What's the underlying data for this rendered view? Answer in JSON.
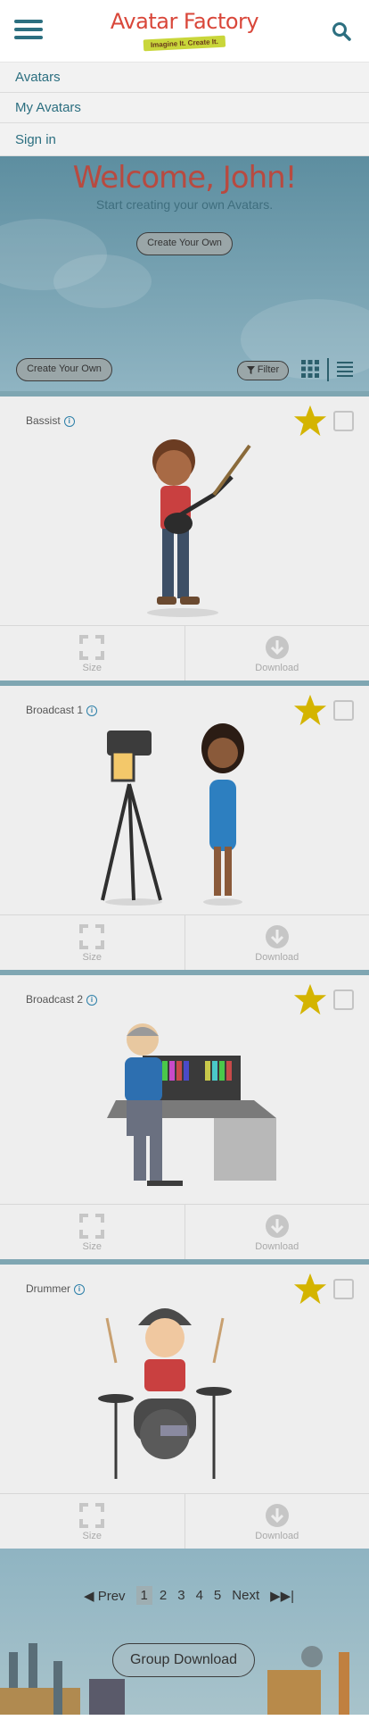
{
  "header": {
    "logo_title": "Avatar Factory",
    "logo_tagline": "Imagine It. Create It."
  },
  "menu": {
    "items": [
      "Avatars",
      "My Avatars",
      "Sign in"
    ]
  },
  "hero": {
    "title": "Welcome, John!",
    "subtitle": "Start creating your own Avatars.",
    "create_button": "Create Your Own"
  },
  "toolbar": {
    "create_button": "Create Your Own",
    "filter_label": "Filter"
  },
  "cards": [
    {
      "title": "Bassist",
      "size_label": "Size",
      "download_label": "Download"
    },
    {
      "title": "Broadcast 1",
      "size_label": "Size",
      "download_label": "Download"
    },
    {
      "title": "Broadcast 2",
      "size_label": "Size",
      "download_label": "Download"
    },
    {
      "title": "Drummer",
      "size_label": "Size",
      "download_label": "Download"
    }
  ],
  "pagination": {
    "prev": "Prev",
    "pages": [
      "1",
      "2",
      "3",
      "4",
      "5"
    ],
    "current": "1",
    "next": "Next"
  },
  "footer": {
    "group_download": "Group Download"
  },
  "colors": {
    "accent": "#2c6f80",
    "logo_red": "#d9473a",
    "star": "#d4b400"
  }
}
